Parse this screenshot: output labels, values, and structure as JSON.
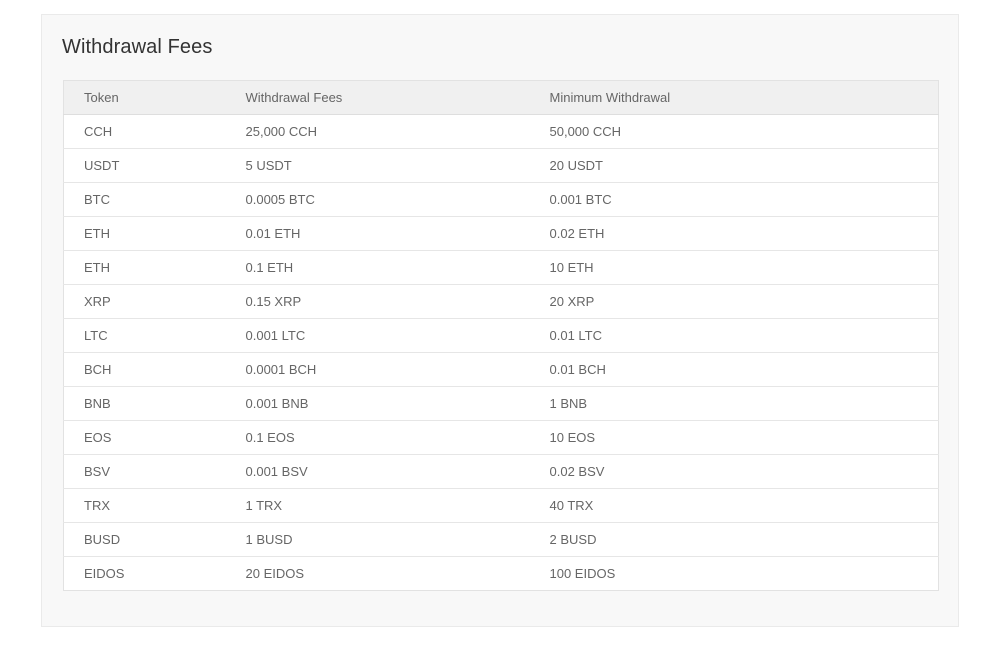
{
  "panel": {
    "title": "Withdrawal Fees"
  },
  "table": {
    "headers": [
      "Token",
      "Withdrawal Fees",
      "Minimum Withdrawal"
    ],
    "rows": [
      [
        "CCH",
        "25,000 CCH",
        "50,000 CCH"
      ],
      [
        "USDT",
        "5 USDT",
        "20 USDT"
      ],
      [
        "BTC",
        "0.0005 BTC",
        "0.001 BTC"
      ],
      [
        "ETH",
        "0.01 ETH",
        "0.02 ETH"
      ],
      [
        "ETH",
        "0.1 ETH",
        "10 ETH"
      ],
      [
        "XRP",
        "0.15 XRP",
        "20 XRP"
      ],
      [
        "LTC",
        "0.001 LTC",
        "0.01 LTC"
      ],
      [
        "BCH",
        "0.0001 BCH",
        "0.01 BCH"
      ],
      [
        "BNB",
        "0.001 BNB",
        "1 BNB"
      ],
      [
        "EOS",
        "0.1 EOS",
        "10 EOS"
      ],
      [
        "BSV",
        "0.001 BSV",
        "0.02 BSV"
      ],
      [
        "TRX",
        "1 TRX",
        "40 TRX"
      ],
      [
        "BUSD",
        "1 BUSD",
        "2 BUSD"
      ],
      [
        "EIDOS",
        "20 EIDOS",
        "100 EIDOS"
      ]
    ]
  }
}
